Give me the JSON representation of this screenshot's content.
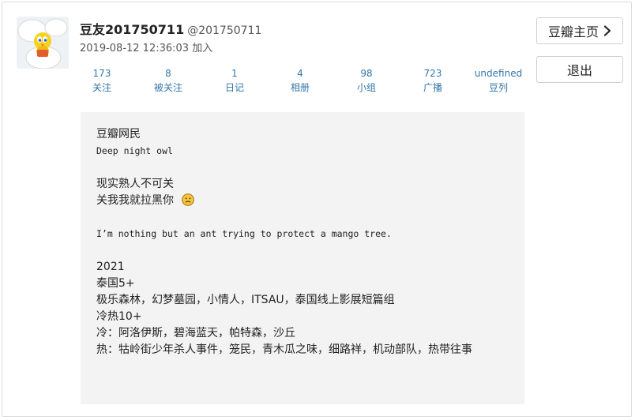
{
  "profile": {
    "name": "豆友201750711",
    "handle": "@201750711",
    "joined": "2019-08-12 12:36:03 加入"
  },
  "stats": [
    {
      "value": "173",
      "label": "关注"
    },
    {
      "value": "8",
      "label": "被关注"
    },
    {
      "value": "1",
      "label": "日记"
    },
    {
      "value": "4",
      "label": "相册"
    },
    {
      "value": "98",
      "label": "小组"
    },
    {
      "value": "723",
      "label": "广播"
    },
    {
      "value": "undefined",
      "label": "豆列"
    }
  ],
  "buttons": {
    "home": "豆瓣主页",
    "logout": "退出"
  },
  "bio": {
    "l1": "豆瓣网民",
    "l2": "Deep night owl",
    "l3": "现实熟人不可关",
    "l4": "关我我就拉黑你",
    "l5": "I’m nothing but an ant trying to protect a mango tree.",
    "l6": "2021",
    "l7": "泰国5+",
    "l8": "极乐森林，幻梦墓园，小情人，ITSAU，泰国线上影展短篇组",
    "l9": "冷热10+",
    "l10": "冷：阿洛伊斯，碧海蓝天，帕特森，沙丘",
    "l11": "热：牯岭街少年杀人事件，笼民，青木瓜之味，细路祥，机动部队，热带往事"
  },
  "icons": {
    "avatar": "tweety-bird-avatar",
    "chevron": "chevron-right-icon",
    "emoji": "frowning-face-icon"
  }
}
